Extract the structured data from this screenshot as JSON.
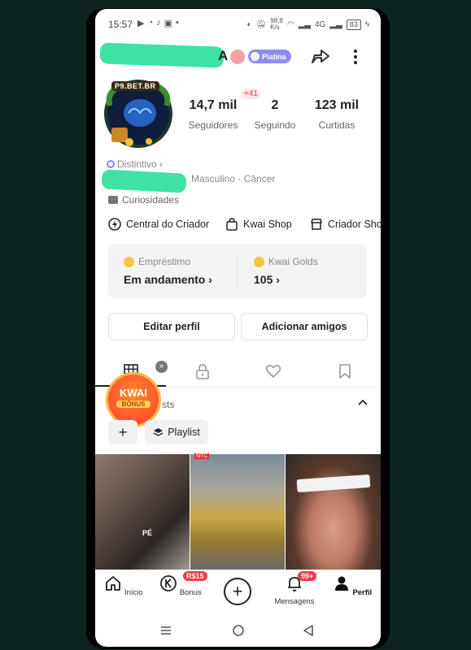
{
  "status_bar": {
    "time": "15:57",
    "left_icons": [
      "play-icon",
      "whatsapp-icon",
      "tiktok-icon",
      "gallery-icon",
      "dot"
    ],
    "net_speed_value": "98,8",
    "net_speed_unit": "K/s",
    "network": "4G",
    "battery": "83"
  },
  "profile": {
    "name_visible_suffix": "A",
    "level_badge": "Platina",
    "avatar_text": "P9.BET.BR",
    "stats": [
      {
        "value": "14,7 mil",
        "label": "Seguidores"
      },
      {
        "value": "2",
        "label": "Seguindo"
      },
      {
        "value": "123 mil",
        "label": "Curtidas"
      }
    ],
    "new_followers_badge": "+41",
    "distintivo": "Distintivo",
    "distintivo_chevron": "›",
    "gender_zodiac": "Masculino · Câncer",
    "curiosidades": "Curiosidades"
  },
  "shortcuts": [
    {
      "label": "Central do Criador",
      "icon": "lightning-icon"
    },
    {
      "label": "Kwai Shop",
      "icon": "bag-icon"
    },
    {
      "label": "Criador Sho",
      "icon": "shop-icon"
    }
  ],
  "wallet": {
    "loan_title": "Empréstimo",
    "loan_value": "Em andamento ›",
    "golds_title": "Kwai Golds",
    "golds_value": "105 ›"
  },
  "actions": {
    "edit": "Editar perfil",
    "add_friends": "Adicionar amigos"
  },
  "tabs": {
    "icons": [
      "grid-icon",
      "lock-icon",
      "heart-icon",
      "bookmark-icon"
    ],
    "close": "×"
  },
  "bonus_sticker": {
    "line1": "KWAI",
    "line2": "BÔNUS"
  },
  "collection": {
    "posts_label_fragment": "sts",
    "add": "+",
    "playlist": "Playlist"
  },
  "videos": {
    "tag": "NTC",
    "thumb2_caption": "PÉ"
  },
  "bottom_nav": [
    {
      "label": "Início",
      "icon": "home-icon"
    },
    {
      "label": "Bonus",
      "icon": "k-coin-icon",
      "badge": "R$15"
    },
    {
      "label": "",
      "icon": "plus-icon"
    },
    {
      "label": "Mensagens",
      "icon": "bell-icon",
      "badge": "99+"
    },
    {
      "label": "Perfil",
      "icon": "person-icon",
      "active": true
    }
  ],
  "colors": {
    "accent_red": "#f0384a",
    "platina_purple": "#8f8cf2",
    "redaction_green": "#3fe2a5",
    "coin_gold": "#f5c83a"
  }
}
